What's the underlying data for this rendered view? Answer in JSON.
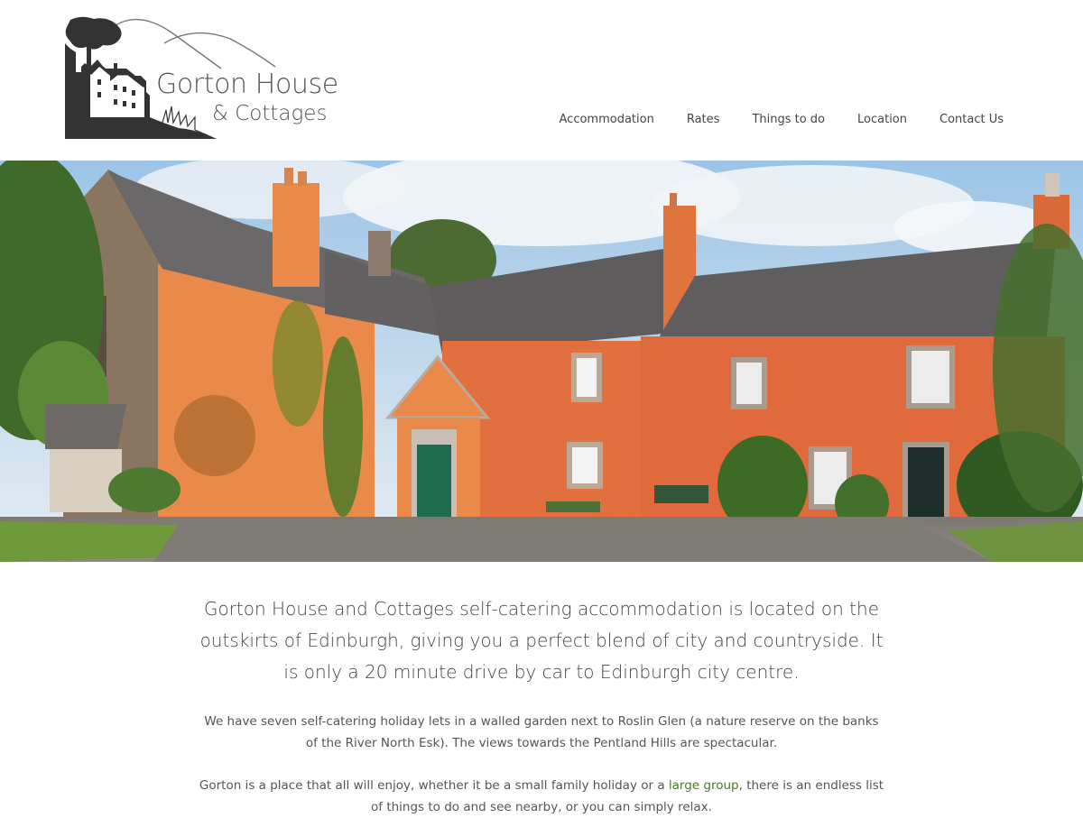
{
  "logo": {
    "line1": "Gorton House",
    "line2": "& Cottages"
  },
  "nav": {
    "items": [
      "Accommodation",
      "Rates",
      "Things to do",
      "Location",
      "Contact Us"
    ]
  },
  "hero": {
    "alt": "Gorton House building exterior"
  },
  "intro": {
    "lead": "Gorton House and Cottages self-catering accommodation is located on the outskirts of Edinburgh, giving you a perfect blend of city and countryside. It is only a 20 minute drive by car to Edinburgh city centre.",
    "para1": "We have seven self-catering holiday lets in a walled garden next to Roslin Glen (a nature reserve on the banks of the River North Esk). The views towards the Pentland Hills are spectacular.",
    "para2_before": "Gorton is a place that all will enjoy, whether it be a small family holiday or a ",
    "para2_link": "large group",
    "para2_after": ", there is an endless list of things to do and see nearby, or you can simply relax."
  },
  "colors": {
    "link": "#4b7a2a",
    "text": "#444444",
    "logo": "#333333"
  }
}
